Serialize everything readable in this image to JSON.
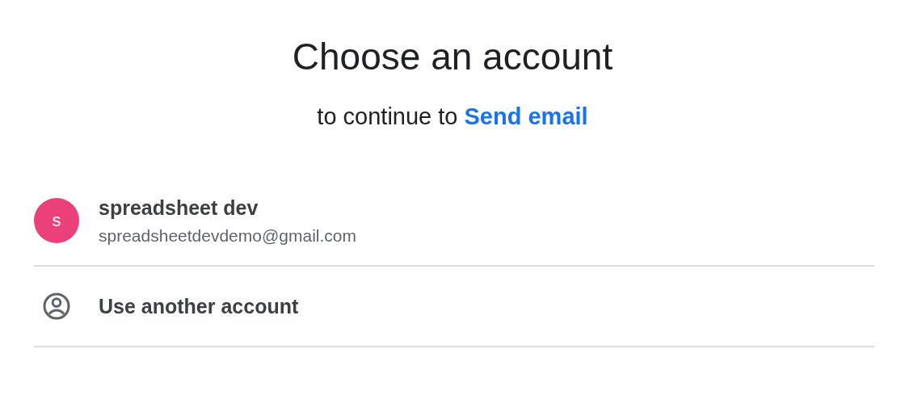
{
  "title": "Choose an account",
  "subtitle": {
    "text": "to continue to",
    "app": "Send email"
  },
  "accounts": [
    {
      "kind": "account",
      "initial": "s",
      "name": "spreadsheet dev",
      "email": "spreadsheetdevdemo@gmail.com"
    },
    {
      "kind": "other",
      "label": "Use another account"
    }
  ]
}
